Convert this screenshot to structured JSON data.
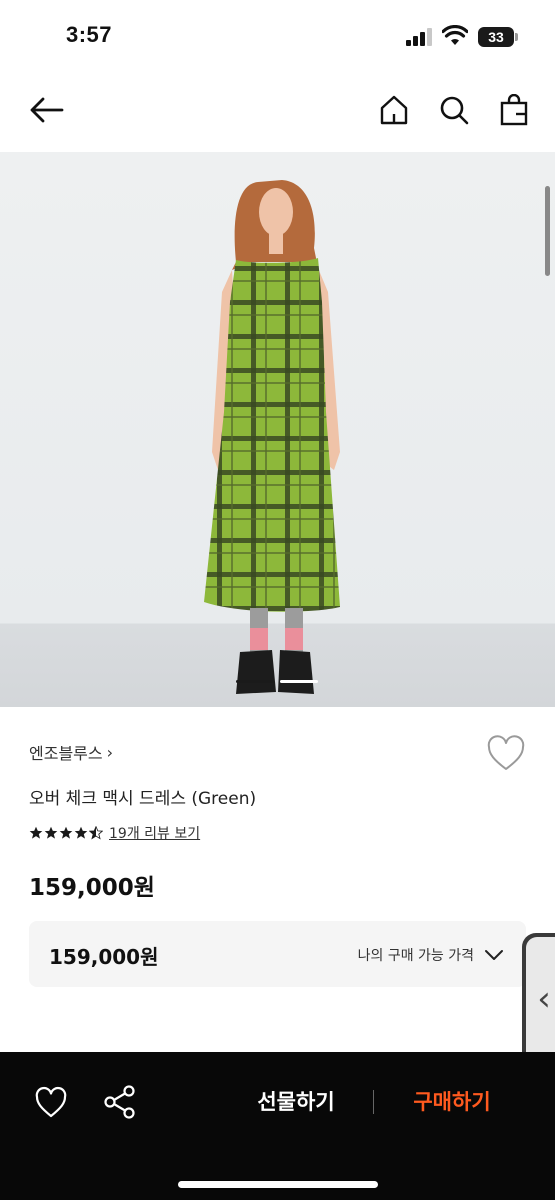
{
  "status_bar": {
    "time": "3:57",
    "battery": "33"
  },
  "nav": {
    "icons": [
      "back-arrow-icon",
      "home-icon",
      "search-icon",
      "shopping-bag-icon"
    ]
  },
  "product": {
    "brand": "엔조블루스",
    "brand_chevron": "›",
    "name": "오버 체크 맥시 드레스 (Green)",
    "rating": 4.5,
    "review_link": "19개 리뷰 보기",
    "price": "159,000원",
    "dress_color": "#8db83a"
  },
  "my_price": {
    "value": "159,000원",
    "label": "나의 구매 가능 가격"
  },
  "side_handle": {
    "arrow": "‹"
  },
  "bottom_bar": {
    "gift_label": "선물하기",
    "buy_label": "구매하기",
    "buy_color": "#ff5a1f"
  }
}
